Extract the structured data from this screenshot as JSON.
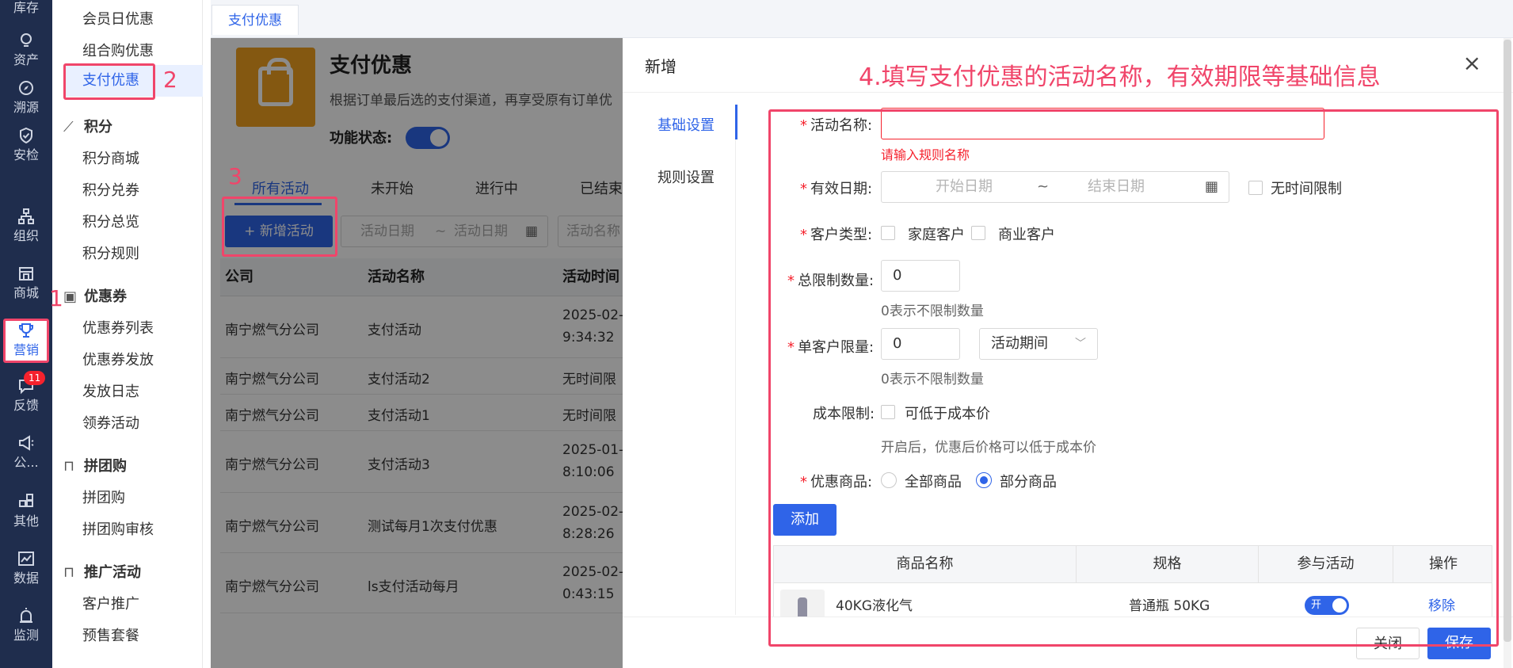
{
  "rail": {
    "items": [
      {
        "label": "库存",
        "icon": "box-icon"
      },
      {
        "label": "资产",
        "icon": "lightbulb-icon"
      },
      {
        "label": "溯源",
        "icon": "compass-icon"
      },
      {
        "label": "安检",
        "icon": "shield-check-icon"
      },
      {
        "label": "组织",
        "icon": "org-chart-icon"
      },
      {
        "label": "商城",
        "icon": "store-icon"
      },
      {
        "label": "营销",
        "icon": "trophy-icon"
      },
      {
        "label": "反馈",
        "icon": "feedback-icon"
      },
      {
        "label": "公...",
        "icon": "megaphone-icon"
      },
      {
        "label": "其他",
        "icon": "grid-plus-icon"
      },
      {
        "label": "数据",
        "icon": "line-chart-icon"
      },
      {
        "label": "监测",
        "icon": "alarm-icon"
      }
    ],
    "feedback_badge": "11"
  },
  "submenu": {
    "items_top": [
      "会员日优惠",
      "组合购优惠",
      "支付优惠"
    ],
    "groups": [
      {
        "title": "积分",
        "items": [
          "积分商城",
          "积分兑券",
          "积分总览",
          "积分规则"
        ]
      },
      {
        "title": "优惠券",
        "items": [
          "优惠券列表",
          "优惠券发放",
          "发放日志",
          "领券活动"
        ]
      },
      {
        "title": "拼团购",
        "items": [
          "拼团购",
          "拼团购审核"
        ]
      },
      {
        "title": "推广活动",
        "items": [
          "客户推广",
          "预售套餐"
        ]
      }
    ]
  },
  "page_tab": "支付优惠",
  "bg": {
    "title": "支付优惠",
    "desc": "根据订单最后选的支付渠道，再享受原有订单优",
    "func_status_label": "功能状态:",
    "status_tabs": [
      "所有活动",
      "未开始",
      "进行中",
      "已结束"
    ],
    "add_btn": "+ 新增活动",
    "date_start_ph": "活动日期",
    "date_sep": "~",
    "date_end_ph": "活动日期",
    "name_filter_ph": "活动名称",
    "columns": [
      "公司",
      "活动名称",
      "活动时间"
    ],
    "rows": [
      {
        "company": "南宁燃气分公司",
        "name": "支付活动",
        "time1": "2025-02-",
        "time2": "9:34:32"
      },
      {
        "company": "南宁燃气分公司",
        "name": "支付活动2",
        "time1": "无时间限",
        "time2": ""
      },
      {
        "company": "南宁燃气分公司",
        "name": "支付活动1",
        "time1": "无时间限",
        "time2": ""
      },
      {
        "company": "南宁燃气分公司",
        "name": "支付活动3",
        "time1": "2025-01-",
        "time2": "8:10:06"
      },
      {
        "company": "南宁燃气分公司",
        "name": "测试每月1次支付优惠",
        "time1": "2025-02-",
        "time2": "8:28:26"
      },
      {
        "company": "南宁燃气分公司",
        "name": "ls支付活动每月",
        "time1": "2025-02-",
        "time2": "0:43:15"
      }
    ]
  },
  "drawer": {
    "title": "新增",
    "close_icon": "close-icon",
    "vtabs": [
      "基础设置",
      "规则设置"
    ],
    "form": {
      "name_label": "活动名称:",
      "name_value": "",
      "name_error": "请输入规则名称",
      "date_label": "有效日期:",
      "date_start_ph": "开始日期",
      "date_sep": "~",
      "date_end_ph": "结束日期",
      "no_time_limit": "无时间限制",
      "customer_type_label": "客户类型:",
      "customer_home": "家庭客户",
      "customer_business": "商业客户",
      "total_limit_label": "总限制数量:",
      "total_limit_value": "0",
      "total_limit_hint": "0表示不限制数量",
      "per_customer_label": "单客户限量:",
      "per_customer_value": "0",
      "per_customer_period": "活动期间",
      "per_customer_hint": "0表示不限制数量",
      "cost_label": "成本限制:",
      "cost_option": "可低于成本价",
      "cost_hint": "开启后，优惠后价格可以低于成本价",
      "goods_label": "优惠商品:",
      "goods_all": "全部商品",
      "goods_partial": "部分商品",
      "add_btn": "添加"
    },
    "goods_table": {
      "columns": [
        "商品名称",
        "规格",
        "参与活动",
        "操作"
      ],
      "row": {
        "name": "40KG液化气",
        "spec": "普通瓶 50KG",
        "toggle": "开",
        "action": "移除"
      }
    },
    "footer": {
      "close": "关闭",
      "save": "保存"
    }
  },
  "annotations": {
    "n1": "1",
    "n2": "2",
    "n3": "3",
    "step4": "4.填写支付优惠的活动名称，有效期限等基础信息"
  },
  "colors": {
    "accent": "#2f64e8",
    "annotation": "#f0456a",
    "error": "#f5222d"
  }
}
